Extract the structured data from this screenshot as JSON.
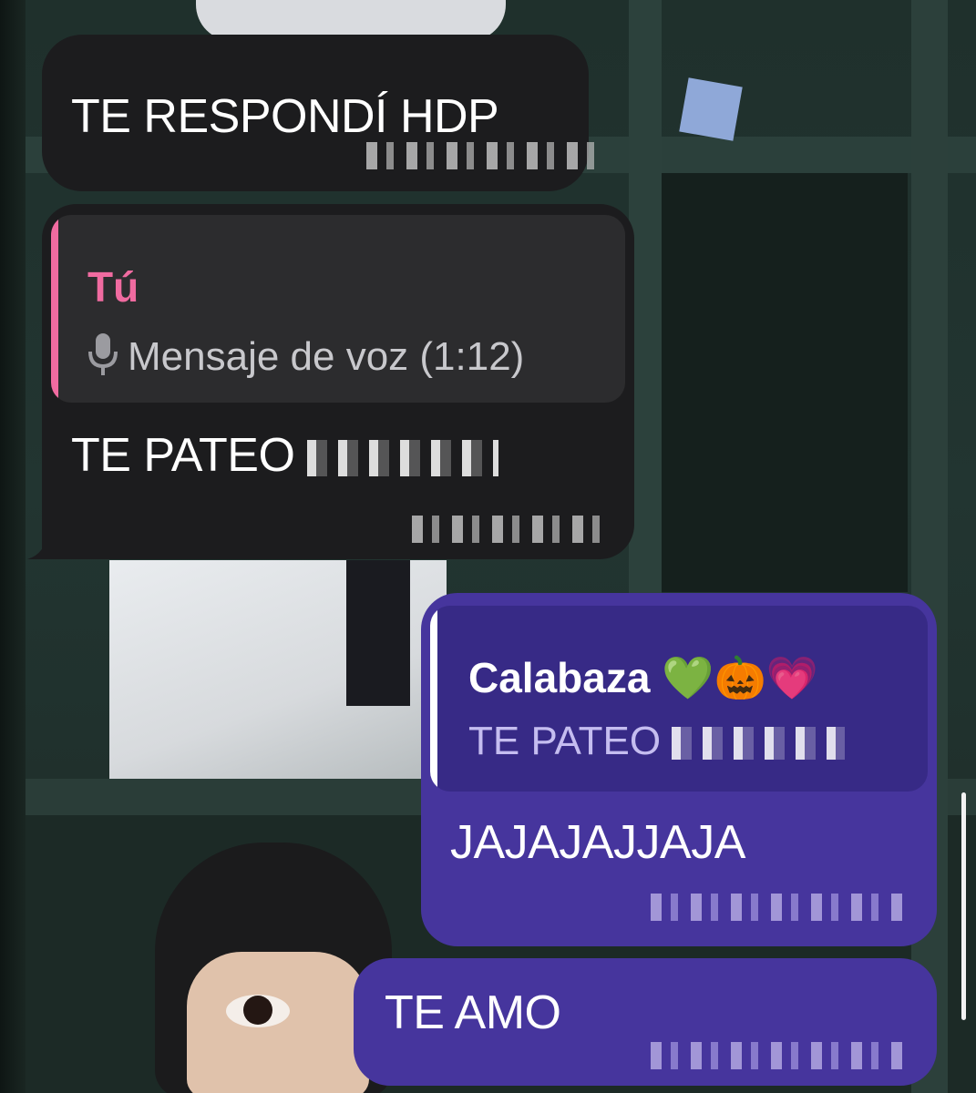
{
  "messages": [
    {
      "direction": "incoming",
      "text": "TE RESPONDÍ HDP"
    },
    {
      "direction": "incoming",
      "reply_to": {
        "author": "Tú",
        "author_color": "#f06ba0",
        "body": "Mensaje de voz (1:12)",
        "icon": "microphone-icon"
      },
      "text": "TE PATEO"
    },
    {
      "direction": "outgoing",
      "reply_to": {
        "author": "Calabaza 💚🎃💗",
        "author_color": "#ffffff",
        "body": "TE PATEO"
      },
      "text": "JAJAJAJJAJA"
    },
    {
      "direction": "outgoing",
      "text": "TE AMO"
    }
  ],
  "colors": {
    "incoming_bubble": "#1c1c1e",
    "outgoing_bubble": "#46359d",
    "incoming_quote_bg": "#2c2c2e",
    "outgoing_quote_bg": "#372a86"
  }
}
